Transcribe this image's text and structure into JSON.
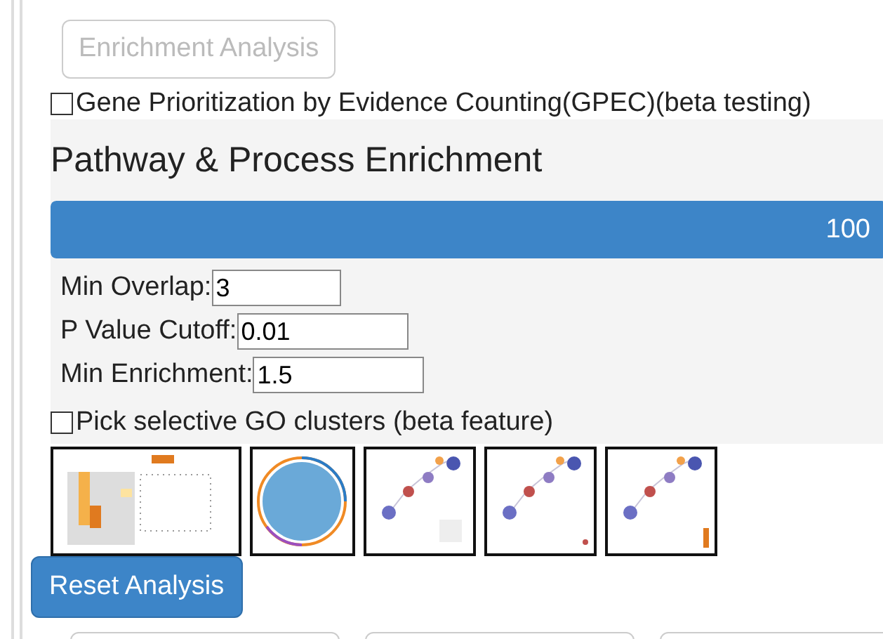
{
  "analysis_button": {
    "label": "Enrichment Analysis",
    "disabled": true
  },
  "gpec_option": {
    "label": "Gene Prioritization by Evidence Counting(GPEC)(beta testing)",
    "checked": false
  },
  "panel": {
    "title": "Pathway & Process Enrichment",
    "progress": {
      "level": 1,
      "reading": "100"
    },
    "fields": [
      {
        "label": "Min Overlap:",
        "value": "3"
      },
      {
        "label": "P Value Cutoff:",
        "value": "0.01"
      },
      {
        "label": "Min Enrichment:",
        "value": "1.5"
      }
    ],
    "go_option": {
      "label": "Pick selective GO clusters (beta feature)",
      "checked": false
    }
  },
  "reset_button": {
    "label": "Reset Analysis"
  }
}
